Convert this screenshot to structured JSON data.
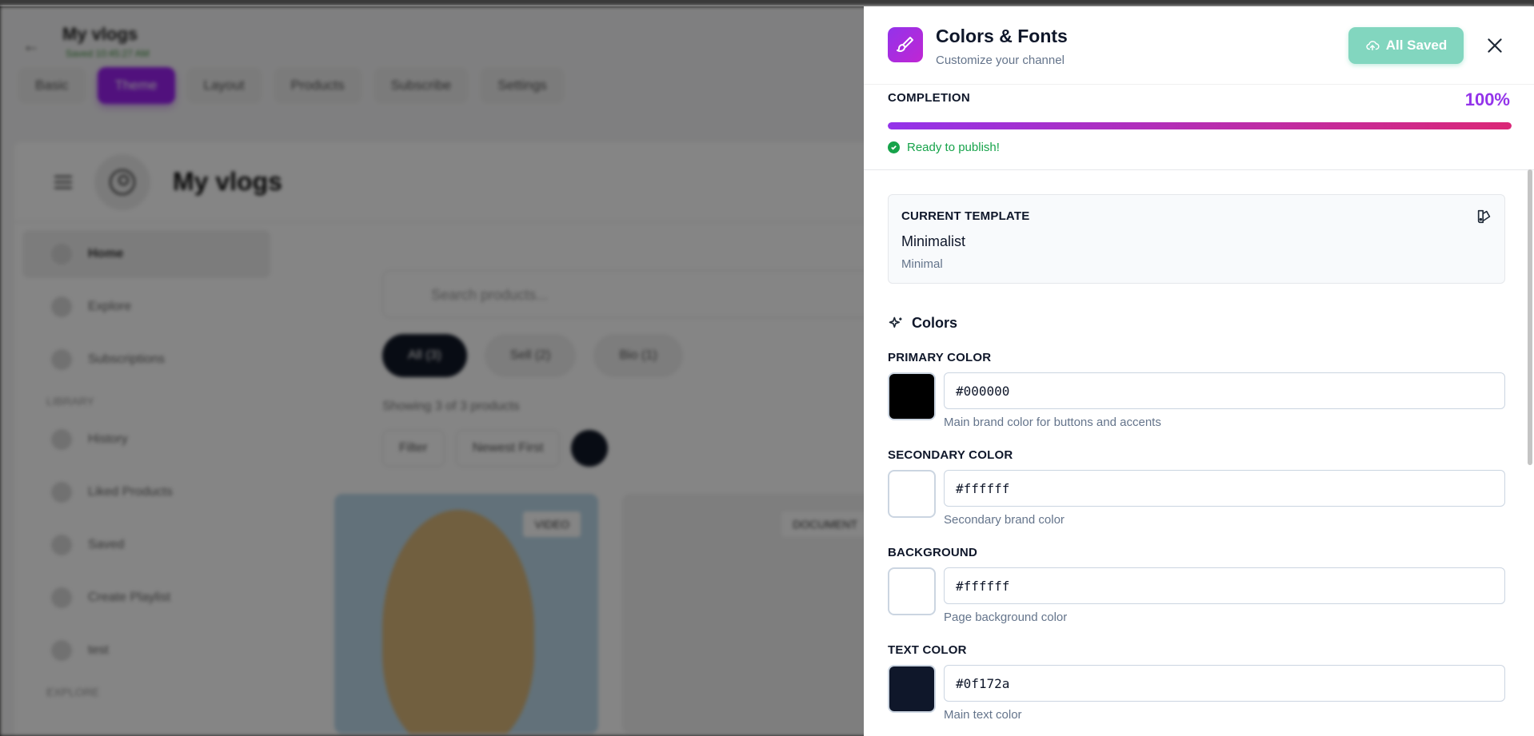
{
  "background": {
    "back_arrow": "←",
    "title": "My vlogs",
    "subtitle": "Saved 10:45:27 AM",
    "tabs": [
      "Basic",
      "Theme",
      "Layout",
      "Products",
      "Subscribe",
      "Settings"
    ],
    "preview": {
      "channel_title": "My vlogs",
      "sidebar": [
        "Home",
        "Explore",
        "Subscriptions"
      ],
      "sidebar_section": "LIBRARY",
      "library_items": [
        "History",
        "Liked Products",
        "Saved",
        "Create Playlist",
        "test"
      ],
      "explore_label": "EXPLORE",
      "search_placeholder": "Search products...",
      "chips": [
        "All (3)",
        "Sell (2)",
        "Bio (1)"
      ],
      "showing": "Showing 3 of 3 products",
      "filter_label": "Filter",
      "sort_label": "Newest First",
      "card_tags": [
        "VIDEO",
        "DOCUMENT"
      ]
    }
  },
  "panel": {
    "title": "Colors & Fonts",
    "subtitle": "Customize your channel",
    "saved_button": "All Saved",
    "completion": {
      "label": "COMPLETION",
      "value": "100%",
      "fraction": 1.0,
      "status": "Ready to publish!"
    },
    "template": {
      "label": "CURRENT TEMPLATE",
      "name": "Minimalist",
      "kind": "Minimal"
    },
    "colors_heading": "Colors",
    "fields": [
      {
        "label": "PRIMARY COLOR",
        "value": "#000000",
        "help": "Main brand color for buttons and accents",
        "swatch": "#000000"
      },
      {
        "label": "SECONDARY COLOR",
        "value": "#ffffff",
        "help": "Secondary brand color",
        "swatch": "#ffffff"
      },
      {
        "label": "BACKGROUND",
        "value": "#ffffff",
        "help": "Page background color",
        "swatch": "#ffffff"
      },
      {
        "label": "TEXT COLOR",
        "value": "#0f172a",
        "help": "Main text color",
        "swatch": "#0f172a"
      }
    ],
    "accent_color": "#9333ea",
    "success_color": "#16a34a"
  }
}
